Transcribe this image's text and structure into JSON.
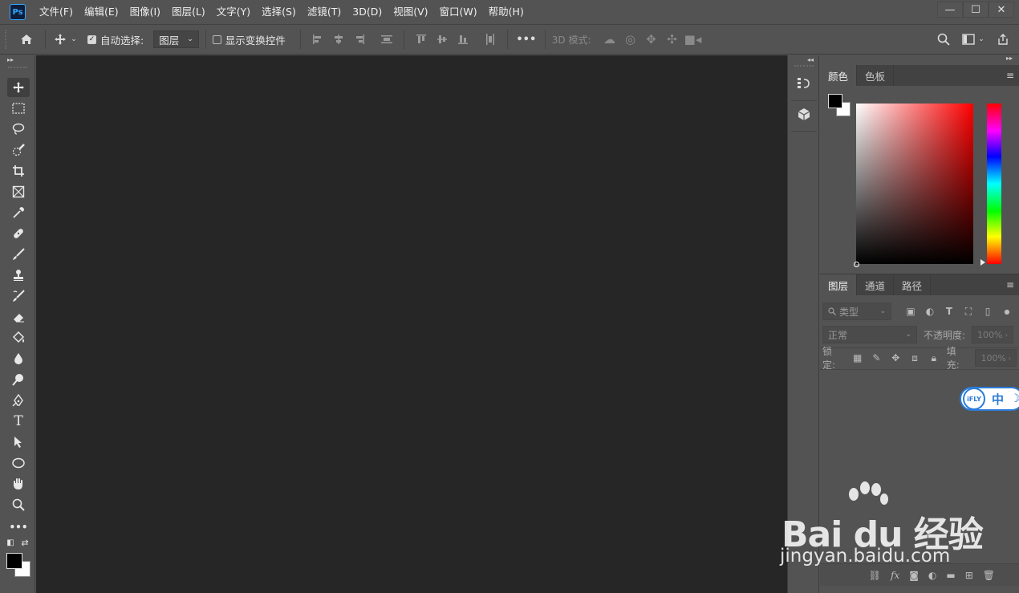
{
  "app": {
    "logo_text": "Ps"
  },
  "menu": [
    "文件(F)",
    "编辑(E)",
    "图像(I)",
    "图层(L)",
    "文字(Y)",
    "选择(S)",
    "滤镜(T)",
    "3D(D)",
    "视图(V)",
    "窗口(W)",
    "帮助(H)"
  ],
  "window_controls": {
    "minimize": "—",
    "maximize": "☐",
    "close": "✕"
  },
  "options": {
    "auto_select_label": "自动选择:",
    "auto_select_checked": true,
    "auto_select_target": "图层",
    "show_transform_label": "显示变换控件",
    "more": "•••",
    "mode_3d_label": "3D 模式:"
  },
  "tools": [
    "move-tool",
    "marquee-tool",
    "lasso-tool",
    "quick-select-tool",
    "crop-tool",
    "frame-tool",
    "eyedropper-tool",
    "healing-brush-tool",
    "brush-tool",
    "clone-stamp-tool",
    "history-brush-tool",
    "eraser-tool",
    "paint-bucket-tool",
    "blur-tool",
    "dodge-tool",
    "pen-tool",
    "type-tool",
    "path-select-tool",
    "ellipse-tool",
    "hand-tool",
    "zoom-tool",
    "edit-toolbar"
  ],
  "color_panel": {
    "tabs": [
      "颜色",
      "色板"
    ],
    "active_tab": 0
  },
  "layers_panel": {
    "tabs": [
      "图层",
      "通道",
      "路径"
    ],
    "active_tab": 0,
    "filter_placeholder": "类型",
    "blend_mode": "正常",
    "opacity_label": "不透明度:",
    "opacity_value": "100%",
    "lock_label": "锁定:",
    "fill_label": "填充:",
    "fill_value": "100%"
  },
  "ifly": {
    "logo": "iFLY",
    "lang": "中",
    "moon": "☽"
  },
  "watermark": {
    "main": "Bai du 经验",
    "sub": "jingyan.baidu.com"
  }
}
